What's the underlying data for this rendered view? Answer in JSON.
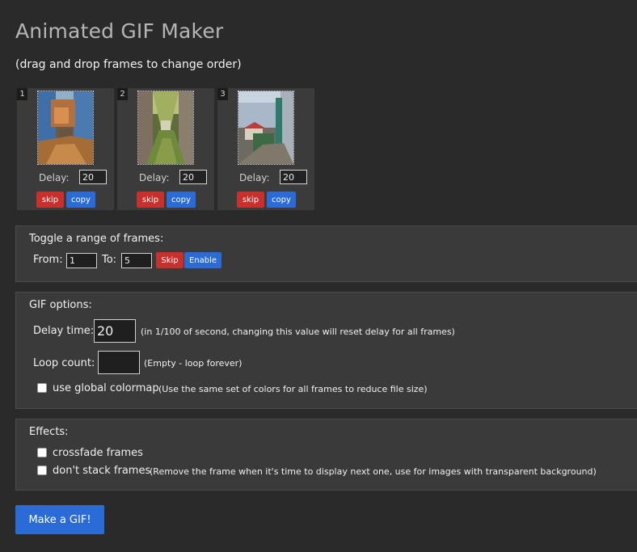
{
  "header": {
    "title": "Animated GIF Maker",
    "subtitle": "(drag and drop frames to change order)"
  },
  "frames": [
    {
      "number": "1",
      "delay_label": "Delay:",
      "delay": "20",
      "skip": "skip",
      "copy": "copy"
    },
    {
      "number": "2",
      "delay_label": "Delay:",
      "delay": "20",
      "skip": "skip",
      "copy": "copy"
    },
    {
      "number": "3",
      "delay_label": "Delay:",
      "delay": "20",
      "skip": "skip",
      "copy": "copy"
    }
  ],
  "toggle": {
    "title": "Toggle a range of frames:",
    "from_label": "From:",
    "from_value": "1",
    "to_label": "To:",
    "to_value": "5",
    "skip": "Skip",
    "enable": "Enable"
  },
  "options": {
    "title": "GIF options:",
    "delay_label": "Delay time:",
    "delay_value": "20",
    "delay_hint": "(in 1/100 of second, changing this value will reset delay for all frames)",
    "loop_label": "Loop count:",
    "loop_value": "",
    "loop_hint": "(Empty - loop forever)",
    "colormap_label": "use global colormap",
    "colormap_hint": "(Use the same set of colors for all frames to reduce file size)",
    "colormap_checked": false
  },
  "effects": {
    "title": "Effects:",
    "crossfade_label": "crossfade frames",
    "crossfade_checked": false,
    "nostack_label": "don't stack frames",
    "nostack_hint": "(Remove the frame when it's time to display next one, use for images with transparent background)",
    "nostack_checked": false
  },
  "make_button": "Make a GIF!",
  "colors": {
    "skip": "#c9302c",
    "primary": "#2a6bd8",
    "background": "#2a2a2a",
    "panel": "#3a3a3a"
  }
}
